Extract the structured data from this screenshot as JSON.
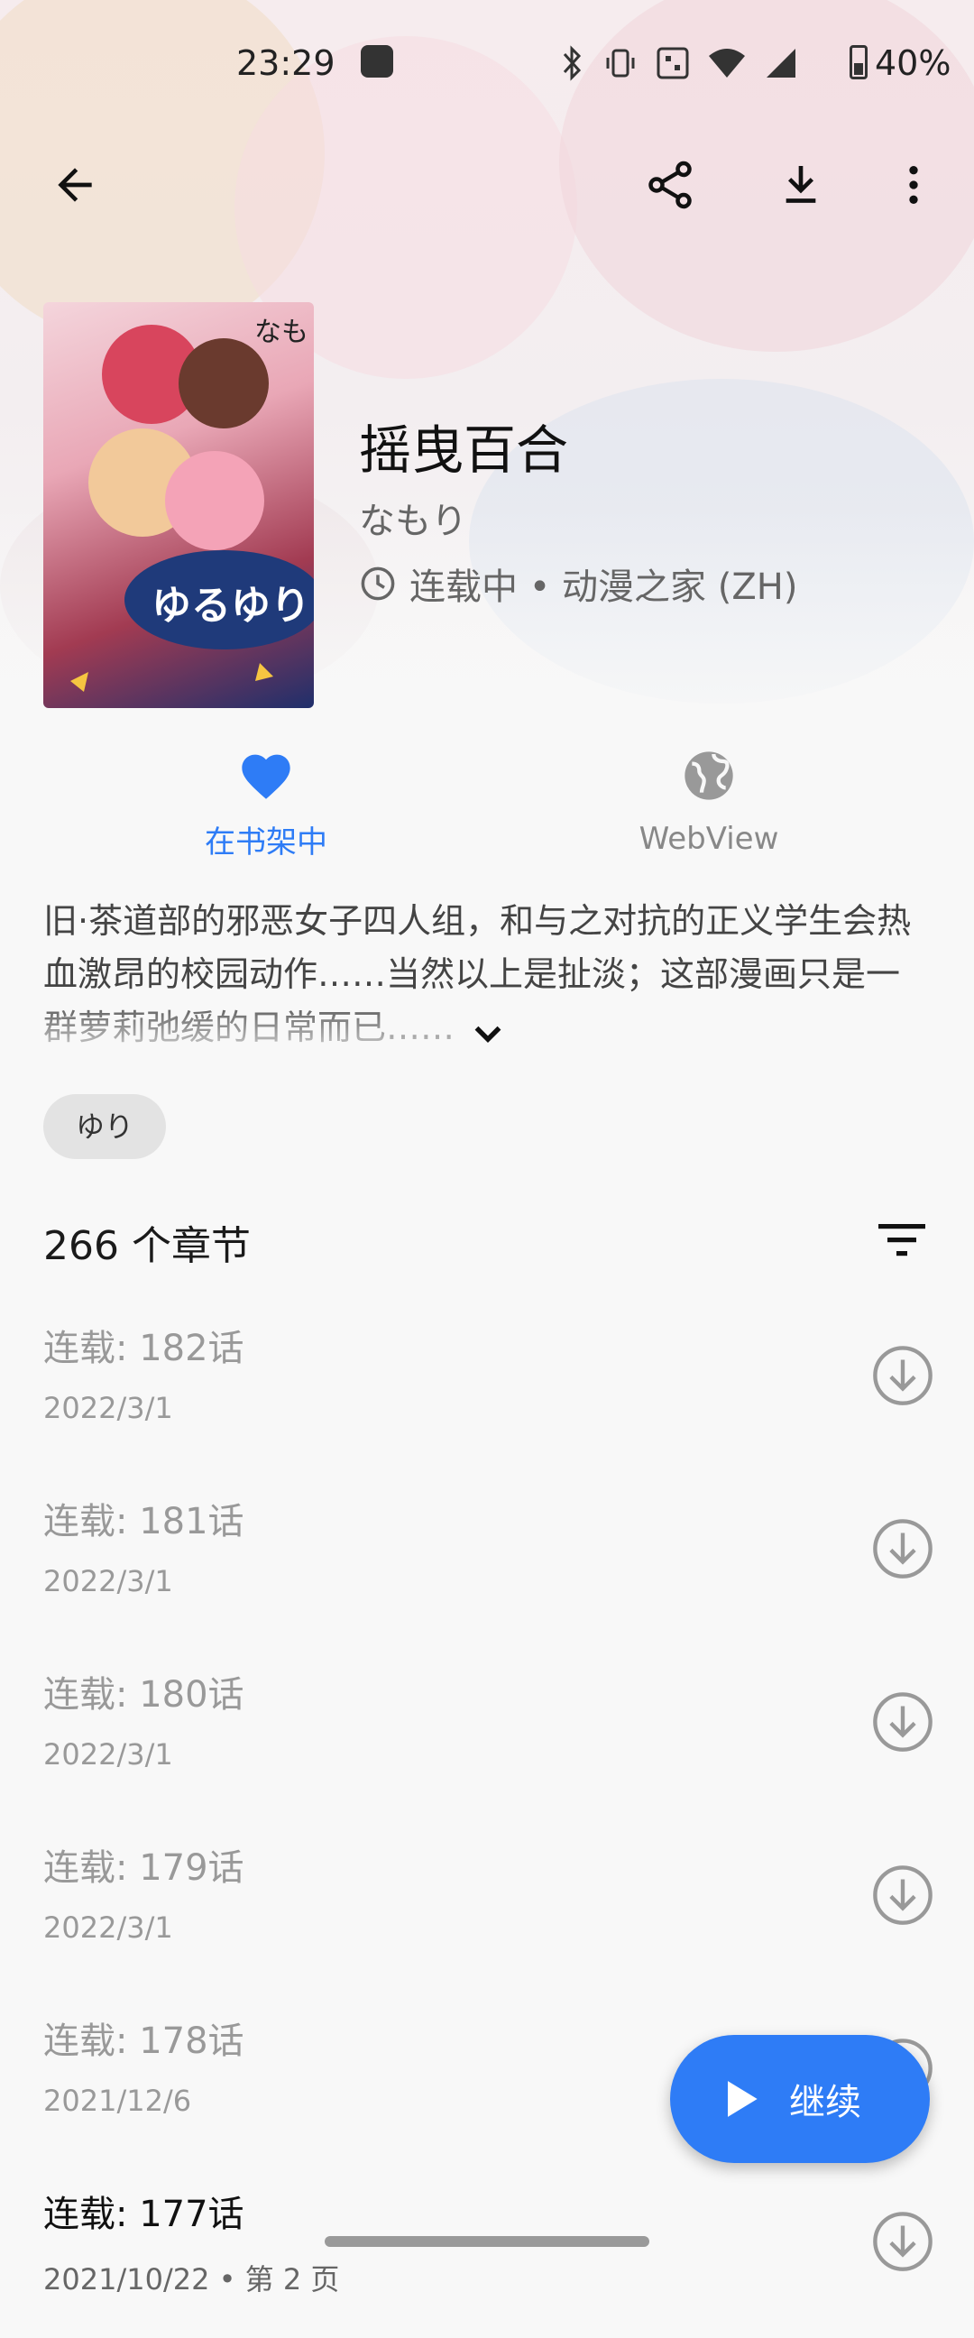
{
  "status_bar": {
    "time": "23:29",
    "battery": "40%",
    "network": "4G"
  },
  "toolbar": {
    "back_icon": "arrow-left-icon",
    "share_icon": "share-icon",
    "download_icon": "download-icon",
    "more_icon": "more-vert-icon"
  },
  "manga": {
    "title": "摇曳百合",
    "author": "なもり",
    "status_source": "连载中 • 动漫之家 (ZH)",
    "cover_text": "なも",
    "cover_logo": "ゆるゆり"
  },
  "actions": {
    "favorite_label": "在书架中",
    "webview_label": "WebView"
  },
  "description": "旧·茶道部的邪恶女子四人组，和与之对抗的正义学生会热血激昂的校园动作……当然以上是扯淡；这部漫画只是一群萝莉弛缓的日常而已……",
  "tags": [
    "ゆり"
  ],
  "chapter_count_label": "266 个章节",
  "chapters": [
    {
      "name": "连载: 182话",
      "date": "2022/3/1",
      "read": true
    },
    {
      "name": "连载: 181话",
      "date": "2022/3/1",
      "read": true
    },
    {
      "name": "连载: 180话",
      "date": "2022/3/1",
      "read": true
    },
    {
      "name": "连载: 179话",
      "date": "2022/3/1",
      "read": true
    },
    {
      "name": "连载: 178话",
      "date": "2021/12/6",
      "read": true
    },
    {
      "name": "连载: 177话",
      "date": "2021/10/22 • 第 2 页",
      "read": false
    }
  ],
  "fab": {
    "label": "继续"
  },
  "colors": {
    "accent": "#2e7cf6",
    "read_text": "#999999",
    "background": "#f8f8f8"
  }
}
